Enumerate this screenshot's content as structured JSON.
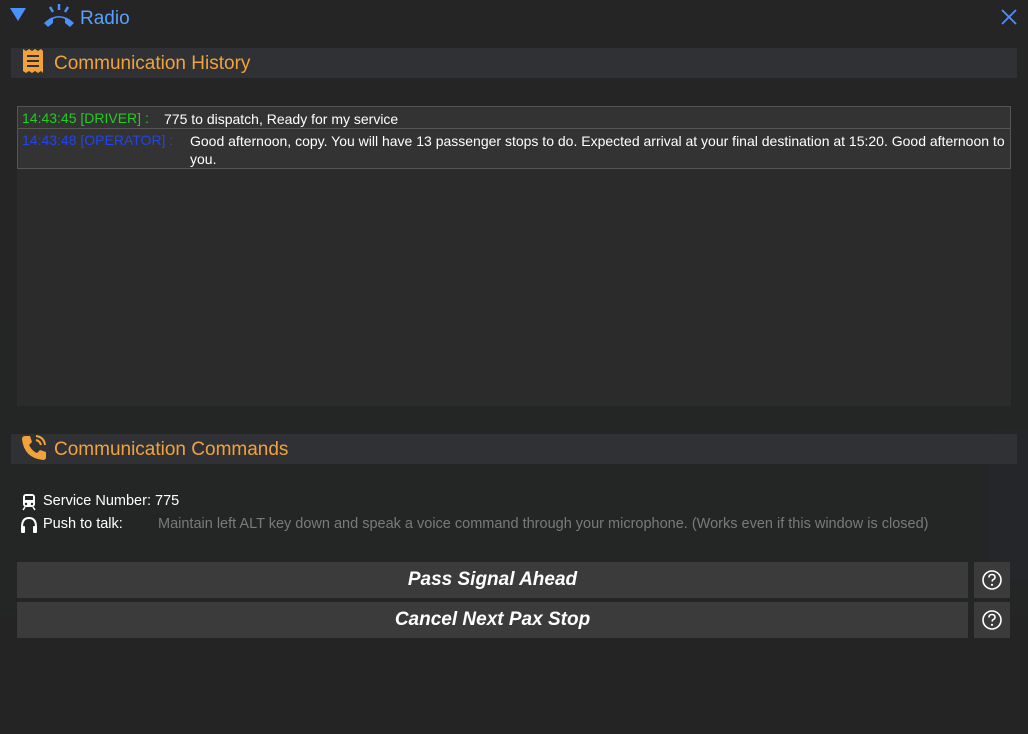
{
  "window": {
    "title": "Radio",
    "close_icon": "close-icon",
    "collapse_icon": "triangle-down-icon",
    "title_icon": "radio-phone-icon"
  },
  "history": {
    "header": "Communication History",
    "icon": "receipt-icon",
    "messages": [
      {
        "who": "14:43:45 [DRIVER] :",
        "who_color": "#22cc22",
        "text": "775 to dispatch, Ready for my service"
      },
      {
        "who": "14:43:48 [OPERATOR] :",
        "who_color": "#2244ee",
        "text": "Good afternoon, copy. You will have 13 passenger stops to do. Expected arrival at your final destination at 15:20. Good afternoon to you."
      }
    ]
  },
  "commands": {
    "header": "Communication Commands",
    "icon": "phone-ringing-icon",
    "service_number_label": "Service Number: 775",
    "push_to_talk_label": "Push to talk:",
    "push_to_talk_hint": "Maintain left ALT key down and speak a voice command through your microphone. (Works even if this window is closed)",
    "buttons": [
      {
        "label": "Pass Signal Ahead"
      },
      {
        "label": "Cancel Next Pax Stop"
      }
    ]
  },
  "colors": {
    "accent_orange": "#f2a23a",
    "title_blue": "#5aa0ff"
  }
}
